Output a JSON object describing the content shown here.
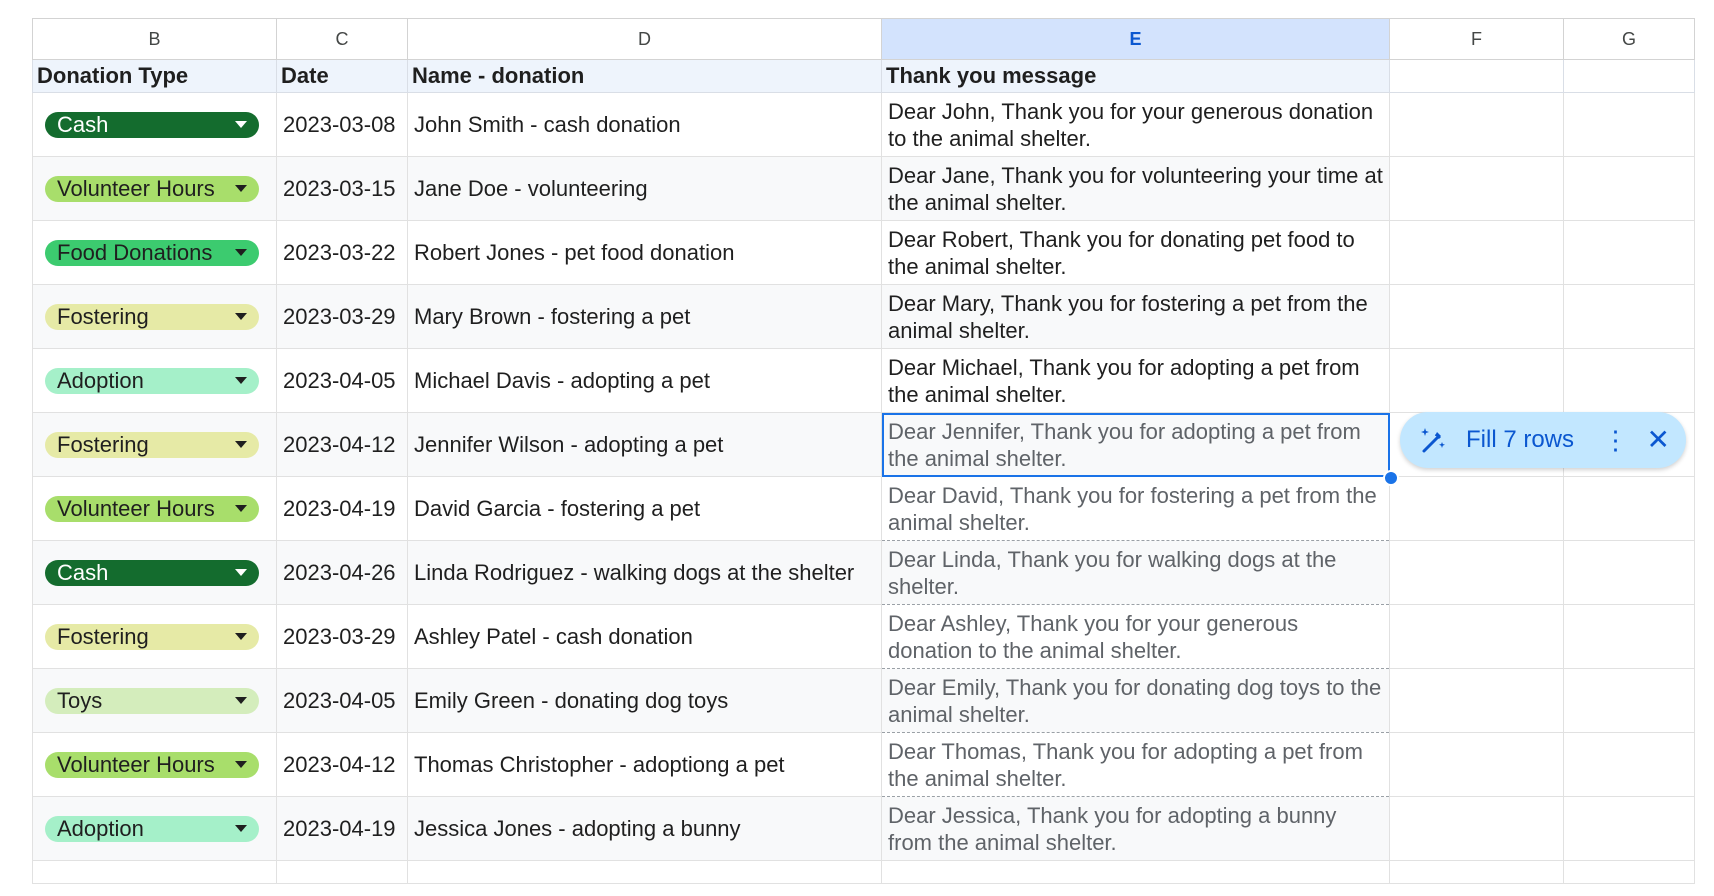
{
  "columns": [
    "B",
    "C",
    "D",
    "E",
    "F",
    "G"
  ],
  "selected_column": "E",
  "headers": {
    "donation_type": "Donation Type",
    "date": "Date",
    "name": "Name - donation",
    "message": "Thank you message"
  },
  "rows": [
    {
      "type": "Cash",
      "type_bg": "#146c2e",
      "type_fg": "#ffffff",
      "date": "2023-03-08",
      "name": "John Smith - cash donation",
      "message": "Dear John, Thank you for your generous donation to the animal shelter."
    },
    {
      "type": "Volunteer Hours",
      "type_bg": "#a8de6b",
      "type_fg": "#1f1f1f",
      "date": "2023-03-15",
      "name": "Jane Doe - volunteering",
      "message": "Dear Jane, Thank you for volunteering your time at the animal shelter."
    },
    {
      "type": "Food Donations",
      "type_bg": "#3ccb6f",
      "type_fg": "#1f1f1f",
      "date": "2023-03-22",
      "name": "Robert Jones - pet food donation",
      "message": "Dear Robert, Thank you for donating pet food to the animal shelter."
    },
    {
      "type": "Fostering",
      "type_bg": "#e6eaa6",
      "type_fg": "#1f1f1f",
      "date": "2023-03-29",
      "name": "Mary Brown - fostering a pet",
      "message": "Dear Mary, Thank you for fostering a pet from the animal shelter."
    },
    {
      "type": "Adoption",
      "type_bg": "#a5f0c9",
      "type_fg": "#1f1f1f",
      "date": "2023-04-05",
      "name": "Michael Davis - adopting a pet",
      "message": "Dear Michael, Thank you for adopting a pet from the animal shelter."
    },
    {
      "type": "Fostering",
      "type_bg": "#e6eaa6",
      "type_fg": "#1f1f1f",
      "date": "2023-04-12",
      "name": "Jennifer Wilson - adopting a pet",
      "message": "Dear Jennifer, Thank you for adopting a pet from the animal shelter."
    },
    {
      "type": "Volunteer Hours",
      "type_bg": "#a8de6b",
      "type_fg": "#1f1f1f",
      "date": "2023-04-19",
      "name": "David Garcia - fostering a pet",
      "message": "Dear David, Thank you for fostering a pet from the animal shelter."
    },
    {
      "type": "Cash",
      "type_bg": "#146c2e",
      "type_fg": "#ffffff",
      "date": "2023-04-26",
      "name": "Linda Rodriguez - walking dogs at the shelter",
      "message": "Dear Linda, Thank you for walking dogs at the shelter."
    },
    {
      "type": "Fostering",
      "type_bg": "#e6eaa6",
      "type_fg": "#1f1f1f",
      "date": "2023-03-29",
      "name": "Ashley Patel - cash donation",
      "message": "Dear Ashley, Thank you for your generous donation to the animal shelter."
    },
    {
      "type": "Toys",
      "type_bg": "#d4edbc",
      "type_fg": "#1f1f1f",
      "date": "2023-04-05",
      "name": "Emily Green - donating dog toys",
      "message": "Dear Emily, Thank you for donating dog toys to the animal shelter."
    },
    {
      "type": "Volunteer Hours",
      "type_bg": "#a8de6b",
      "type_fg": "#1f1f1f",
      "date": "2023-04-12",
      "name": "Thomas Christopher - adoptiong a pet",
      "message": "Dear Thomas, Thank you for adopting a pet from the animal shelter."
    },
    {
      "type": "Adoption",
      "type_bg": "#a5f0c9",
      "type_fg": "#1f1f1f",
      "date": "2023-04-19",
      "name": "Jessica Jones - adopting a bunny",
      "message": "Dear Jessica, Thank you for adopting a bunny from the animal shelter."
    }
  ],
  "active_row_index": 5,
  "fill_popup": {
    "label": "Fill 7 rows",
    "icon": "magic-wand-icon",
    "more_icon": "more-vert-icon",
    "close_icon": "close-icon",
    "bg_color": "#c2e7ff",
    "fg_color": "#0b57d0"
  }
}
